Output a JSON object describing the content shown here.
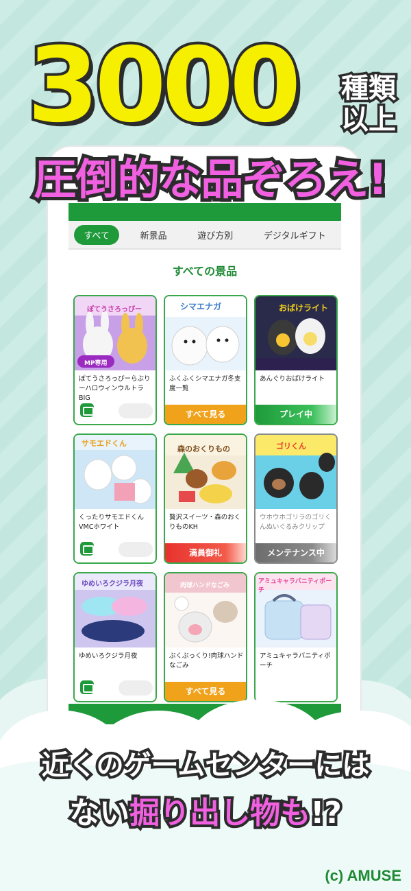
{
  "headline": {
    "number_digits": [
      "3",
      "0",
      "0",
      "0"
    ],
    "kind_line1": "種類",
    "kind_line2": "以上",
    "subline": "圧倒的な品ぞろえ!"
  },
  "tabs": [
    {
      "label": "すべて",
      "active": true
    },
    {
      "label": "新景品",
      "active": false
    },
    {
      "label": "遊び方別",
      "active": false
    },
    {
      "label": "デジタルギフト",
      "active": false
    }
  ],
  "section_title": "すべての景品",
  "cards": [
    {
      "name": "ぽてうさろっぴーらぶりーハロウィンウルトラBIG",
      "action": "",
      "style": "none",
      "thumb_text": "ぽてうさろっぴー",
      "badge": "MP専用"
    },
    {
      "name": "ふくふくシマエナガ冬支度一覧",
      "action": "すべて見る",
      "style": "orange",
      "thumb_text": "シマエナガ"
    },
    {
      "name": "あんぐりおばけライト",
      "action": "プレイ中",
      "style": "green",
      "thumb_text": "おばけライト"
    },
    {
      "name": "くったりサモエドくんVMCホワイト",
      "action": "",
      "style": "none",
      "thumb_text": "サモエドくん"
    },
    {
      "name": "贅沢スイーツ・森のおくりものKH",
      "action": "満員御礼",
      "style": "red",
      "thumb_text": "森のおくりもの"
    },
    {
      "name": "ウホウホゴリラのゴリくんぬいぐるみクリップ",
      "action": "メンテナンス中",
      "style": "gray",
      "thumb_text": "ゴリくん",
      "muted": true
    },
    {
      "name": "ゆめいろクジラ月夜",
      "action": "",
      "style": "none",
      "thumb_text": "ゆめいろクジラ月夜"
    },
    {
      "name": "ぷくぷっくり!肉球ハンドなごみ",
      "action": "すべて見る",
      "style": "orange",
      "thumb_text": "肉球ハンドなごみ"
    },
    {
      "name": "アミュキャラバニティポーチ",
      "action": "",
      "style": "none",
      "thumb_text": "アミュキャラバニティポーチ"
    }
  ],
  "bottom": {
    "line1": "近くのゲームセンターには",
    "line2_a": "ない",
    "line2_pink": "掘り出し物も",
    "line2_b": "!?"
  },
  "copyright": "(c) AMUSE"
}
